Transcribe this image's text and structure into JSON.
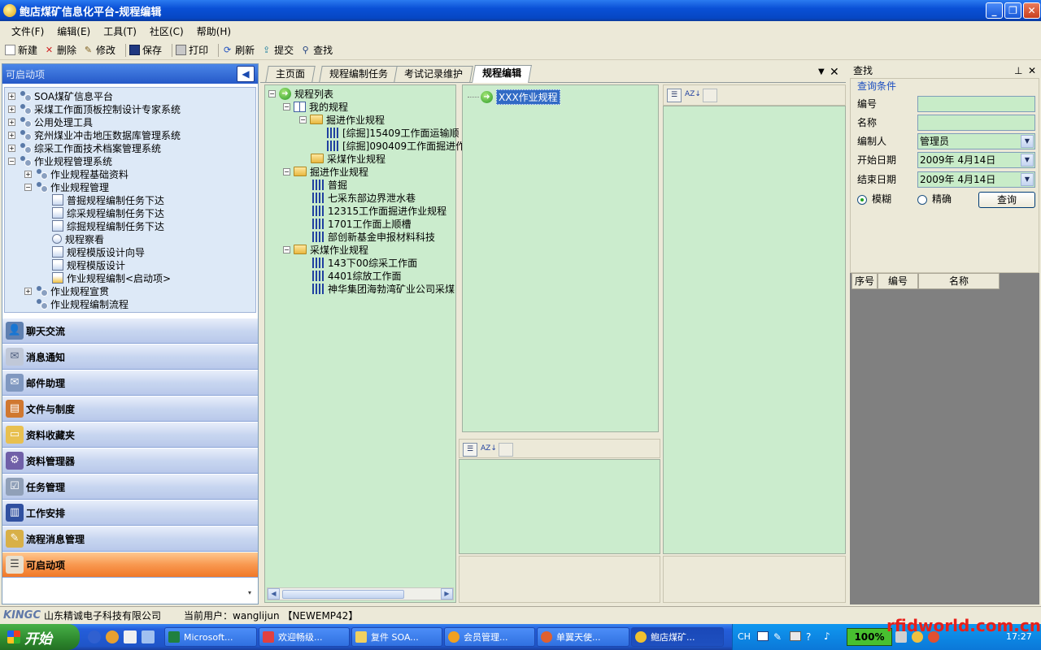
{
  "window": {
    "title": "鲍店煤矿信息化平台-规程编辑"
  },
  "menu": [
    "文件(F)",
    "编辑(E)",
    "工具(T)",
    "社区(C)",
    "帮助(H)"
  ],
  "toolbar": {
    "new": "新建",
    "delete": "删除",
    "modify": "修改",
    "save": "保存",
    "print": "打印",
    "refresh": "刷新",
    "submit": "提交",
    "find": "查找"
  },
  "left_panel": {
    "header": "可启动项",
    "tree": [
      "SOA煤矿信息平台",
      "采煤工作面顶板控制设计专家系统",
      "公用处理工具",
      "兖州煤业冲击地压数据库管理系统",
      "综采工作面技术档案管理系统",
      "作业规程管理系统",
      "作业规程基础资料",
      "作业规程管理",
      "普掘规程编制任务下达",
      "综采规程编制任务下达",
      "综掘规程编制任务下达",
      "规程察看",
      "规程模版设计向导",
      "规程模版设计",
      "作业规程编制<启动项>",
      "作业规程宣贯",
      "作业规程编制流程"
    ],
    "nav": [
      "聊天交流",
      "消息通知",
      "邮件助理",
      "文件与制度",
      "资料收藏夹",
      "资料管理器",
      "任务管理",
      "工作安排",
      "流程消息管理",
      "可启动项"
    ]
  },
  "tabs": [
    "主页面",
    "规程编制任务",
    "考试记录维护",
    "规程编辑"
  ],
  "tree2": {
    "root": "规程列表",
    "items": [
      "我的规程",
      "掘进作业规程",
      "[综掘]15409工作面运输顺",
      "[综掘]090409工作面掘进作",
      "采煤作业规程",
      "掘进作业规程",
      "普掘",
      "七采东部边界泄水巷",
      "12315工作面掘进作业规程",
      "1701工作面上顺槽",
      "部创新基金申报材料科技",
      "采煤作业规程",
      "143下00综采工作面",
      "4401综放工作面",
      "神华集团海勃湾矿业公司采煤"
    ]
  },
  "middle": {
    "selected_item": "XXX作业规程"
  },
  "search": {
    "title": "查找",
    "group": "查询条件",
    "fields": {
      "number": "编号",
      "name": "名称",
      "author": "编制人",
      "start": "开始日期",
      "end": "结束日期"
    },
    "author_value": "管理员",
    "start_value": "2009年 4月14日",
    "end_value": "2009年 4月14日",
    "fuzzy": "模糊",
    "exact": "精确",
    "query_btn": "查询",
    "grid_headers": [
      "序号",
      "编号",
      "名称"
    ]
  },
  "status": {
    "company": "山东精诚电子科技有限公司",
    "user": "当前用户：wanglijun 【NEWEMP42】",
    "logo": "KINGC"
  },
  "taskbar": {
    "start": "开始",
    "tasks": [
      "Microsoft...",
      "欢迎畅级...",
      "复件 SOA...",
      "会员管理...",
      "单翼天使...",
      "鲍店煤矿..."
    ],
    "lang": "CH",
    "zoom": "100%",
    "clock": "17:27"
  },
  "watermark": "rfidworld.com.cn"
}
